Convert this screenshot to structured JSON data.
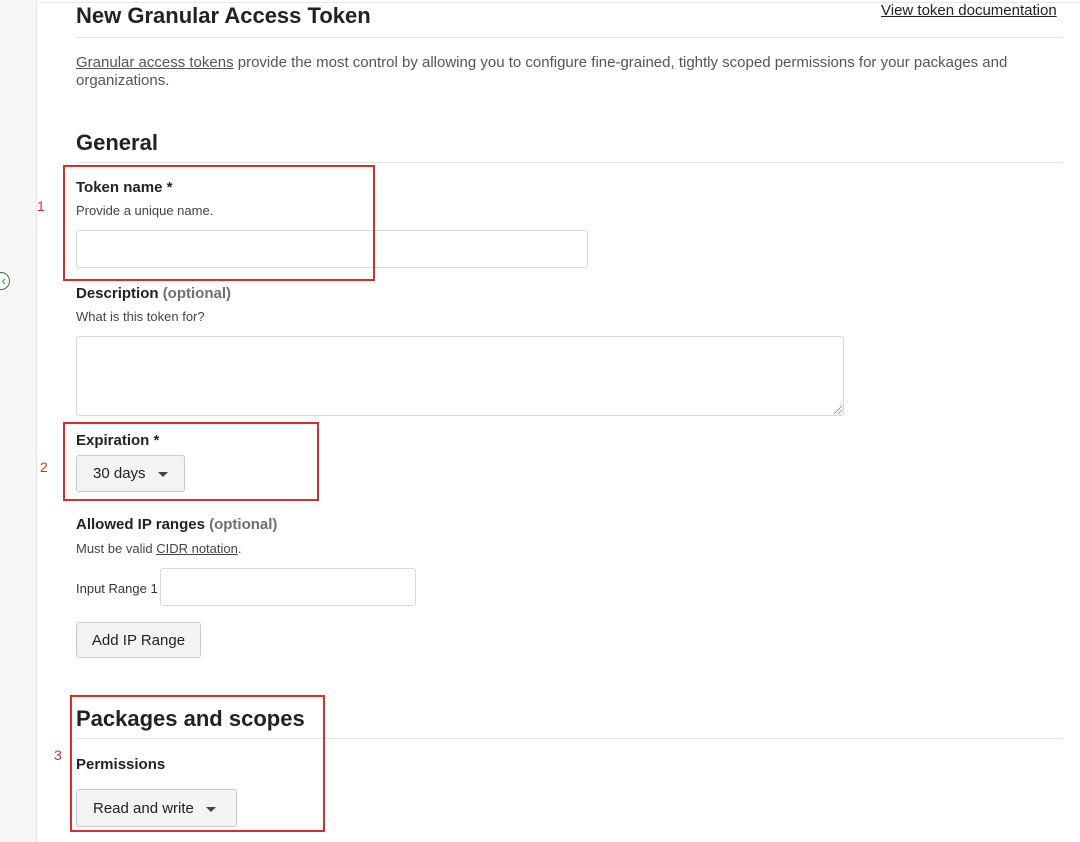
{
  "header": {
    "title": "New Granular Access Token",
    "doc_link": "View token documentation"
  },
  "intro": {
    "link_text": "Granular access tokens",
    "text": " provide the most control by allowing you to configure fine-grained, tightly scoped permissions for your packages and organizations."
  },
  "general": {
    "heading": "General",
    "token_name": {
      "label": "Token name *",
      "hint": "Provide a unique name.",
      "value": ""
    },
    "description": {
      "label": "Description",
      "optional": "(optional)",
      "hint": "What is this token for?",
      "value": ""
    },
    "expiration": {
      "label": "Expiration *",
      "selected": "30 days"
    },
    "ip_ranges": {
      "label": "Allowed IP ranges",
      "optional": "(optional)",
      "hint_prefix": "Must be valid ",
      "hint_link": "CIDR notation",
      "hint_suffix": ".",
      "input_label": "Input Range 1",
      "input_value": "",
      "add_button": "Add IP Range"
    }
  },
  "packages": {
    "heading": "Packages and scopes",
    "permissions_label": "Permissions",
    "permissions_selected": "Read and write"
  },
  "annotations": [
    "1",
    "2",
    "3"
  ],
  "colors": {
    "annotation": "#d32f2f",
    "rail_toggle": "#2e7d32"
  }
}
